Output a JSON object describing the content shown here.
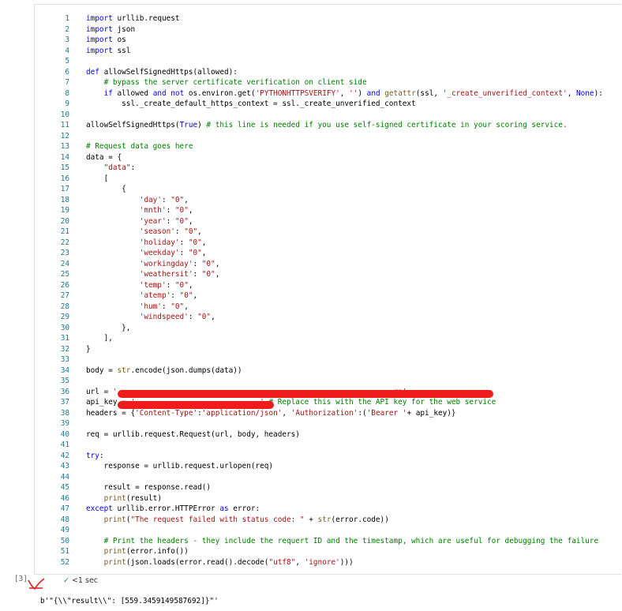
{
  "cell": {
    "execution_count": "[3]",
    "status_text": "<1 sec",
    "output_text": "b'\"{\\\\\"result\\\\\": [559.3459149587692]}\"'"
  },
  "icons": {
    "success": "check-icon"
  },
  "colors": {
    "keyword": "#0000ff",
    "string": "#a31515",
    "comment": "#008000",
    "function": "#795e26",
    "line_number": "#237893",
    "redaction": "#ee1c1c"
  },
  "code_lines": [
    "import urllib.request",
    "import json",
    "import os",
    "import ssl",
    "",
    "def allowSelfSignedHttps(allowed):",
    "    # bypass the server certificate verification on client side",
    "    if allowed and not os.environ.get('PYTHONHTTPSVERIFY', '') and getattr(ssl, '_create_unverified_context', None):",
    "        ssl._create_default_https_context = ssl._create_unverified_context",
    "",
    "allowSelfSignedHttps(True) # this line is needed if you use self-signed certificate in your scoring service.",
    "",
    "# Request data goes here",
    "data = {",
    "    \"data\":",
    "    [",
    "        {",
    "            'day': \"0\",",
    "            'mnth': \"0\",",
    "            'year': \"0\",",
    "            'season': \"0\",",
    "            'holiday': \"0\",",
    "            'weekday': \"0\",",
    "            'workingday': \"0\",",
    "            'weathersit': \"0\",",
    "            'temp': \"0\",",
    "            'atemp': \"0\",",
    "            'hum': \"0\",",
    "            'windspeed': \"0\",",
    "        },",
    "    ],",
    "}",
    "",
    "body = str.encode(json.dumps(data))",
    "",
    "url = '                                                              re'",
    "api_key = '                            ' # Replace this with the API key for the web service",
    "headers = {'Content-Type':'application/json', 'Authorization':('Bearer '+ api_key)}",
    "",
    "req = urllib.request.Request(url, body, headers)",
    "",
    "try:",
    "    response = urllib.request.urlopen(req)",
    "",
    "    result = response.read()",
    "    print(result)",
    "except urllib.error.HTTPError as error:",
    "    print(\"The request failed with status code: \" + str(error.code))",
    "",
    "    # Print the headers - they include the requert ID and the timestamp, which are useful for debugging the failure",
    "    print(error.info())",
    "    print(json.loads(error.read().decode(\"utf8\", 'ignore')))"
  ]
}
